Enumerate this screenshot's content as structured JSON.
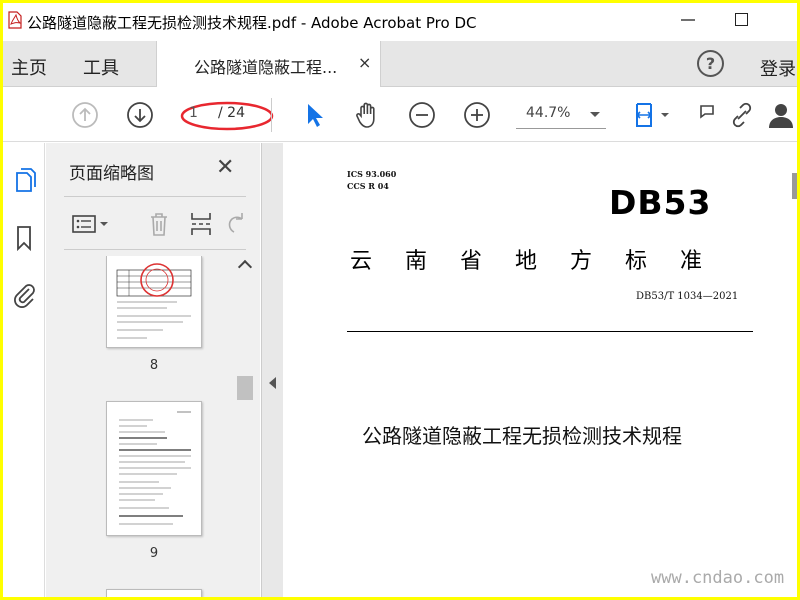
{
  "window": {
    "title": "公路隧道隐蔽工程无损检测技术规程.pdf - Adobe Acrobat Pro DC"
  },
  "menu": {
    "home": "主页",
    "tools": "工具",
    "doc_tab": "公路隧道隐蔽工程...",
    "close_tab": "×",
    "help": "?",
    "login": "登录"
  },
  "toolbar": {
    "page_current": "1",
    "page_total": "/ 24",
    "zoom": "44.7%"
  },
  "thumb_panel": {
    "title": "页面缩略图",
    "close": "✕",
    "thumbnails": [
      {
        "label": "8"
      },
      {
        "label": "9"
      }
    ]
  },
  "document": {
    "ics": "ICS 93.060",
    "ccs": "CCS R 04",
    "db": "DB53",
    "standard_type": "云南省地方标准",
    "number": "DB53/T  1034—2021",
    "title": "公路隧道隐蔽工程无损检测技术规程"
  },
  "watermark": "www.cndao.com",
  "colors": {
    "frame": "#ffff00",
    "accent": "#1473e6",
    "annotation": "#e8272f"
  }
}
